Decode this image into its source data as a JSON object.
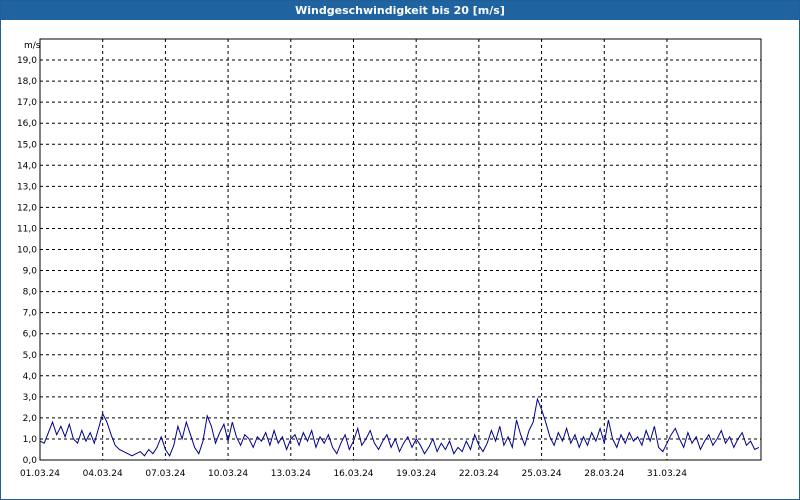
{
  "window": {
    "title": "Windgeschwindigkeit bis 20 [m/s]"
  },
  "colors": {
    "titlebar": "#1f64a0",
    "series": "#00008b",
    "grid": "#000000"
  },
  "chart_data": {
    "type": "line",
    "title": "Windgeschwindigkeit bis 20 [m/s]",
    "ylabel": "m/s",
    "ylim": [
      0,
      20
    ],
    "xlim_days": [
      1,
      35.5
    ],
    "grid": true,
    "yticks": [
      "0,0",
      "1,0",
      "2,0",
      "3,0",
      "4,0",
      "5,0",
      "6,0",
      "7,0",
      "8,0",
      "9,0",
      "10,0",
      "11,0",
      "12,0",
      "13,0",
      "14,0",
      "15,0",
      "16,0",
      "17,0",
      "18,0",
      "19,0"
    ],
    "xticks": [
      {
        "label": "01.03.24",
        "day": 1
      },
      {
        "label": "04.03.24",
        "day": 4
      },
      {
        "label": "07.03.24",
        "day": 7
      },
      {
        "label": "10.03.24",
        "day": 10
      },
      {
        "label": "13.03.24",
        "day": 13
      },
      {
        "label": "16.03.24",
        "day": 16
      },
      {
        "label": "19.03.24",
        "day": 19
      },
      {
        "label": "22.03.24",
        "day": 22
      },
      {
        "label": "25.03.24",
        "day": 25
      },
      {
        "label": "28.03.24",
        "day": 28
      },
      {
        "label": "31.03.24",
        "day": 31
      }
    ],
    "series": [
      {
        "values": [
          [
            1.0,
            0.9
          ],
          [
            1.2,
            0.8
          ],
          [
            1.4,
            1.3
          ],
          [
            1.6,
            1.8
          ],
          [
            1.8,
            1.2
          ],
          [
            2.0,
            1.6
          ],
          [
            2.2,
            1.1
          ],
          [
            2.4,
            1.7
          ],
          [
            2.6,
            1.0
          ],
          [
            2.8,
            0.8
          ],
          [
            3.0,
            1.4
          ],
          [
            3.2,
            0.9
          ],
          [
            3.4,
            1.3
          ],
          [
            3.6,
            0.8
          ],
          [
            3.8,
            1.5
          ],
          [
            4.0,
            2.2
          ],
          [
            4.2,
            1.8
          ],
          [
            4.4,
            1.2
          ],
          [
            4.6,
            0.7
          ],
          [
            4.8,
            0.5
          ],
          [
            5.0,
            0.4
          ],
          [
            5.2,
            0.3
          ],
          [
            5.4,
            0.2
          ],
          [
            5.6,
            0.3
          ],
          [
            5.8,
            0.4
          ],
          [
            6.0,
            0.2
          ],
          [
            6.2,
            0.5
          ],
          [
            6.4,
            0.3
          ],
          [
            6.6,
            0.6
          ],
          [
            6.8,
            1.1
          ],
          [
            7.0,
            0.5
          ],
          [
            7.2,
            0.2
          ],
          [
            7.4,
            0.7
          ],
          [
            7.6,
            1.6
          ],
          [
            7.8,
            1.0
          ],
          [
            8.0,
            1.8
          ],
          [
            8.2,
            1.2
          ],
          [
            8.4,
            0.6
          ],
          [
            8.6,
            0.3
          ],
          [
            8.8,
            0.9
          ],
          [
            9.0,
            2.1
          ],
          [
            9.2,
            1.6
          ],
          [
            9.4,
            0.8
          ],
          [
            9.6,
            1.3
          ],
          [
            9.8,
            1.7
          ],
          [
            10.0,
            0.9
          ],
          [
            10.2,
            1.8
          ],
          [
            10.4,
            1.1
          ],
          [
            10.6,
            0.7
          ],
          [
            10.8,
            1.2
          ],
          [
            11.0,
            1.0
          ],
          [
            11.2,
            0.6
          ],
          [
            11.4,
            1.1
          ],
          [
            11.6,
            0.9
          ],
          [
            11.8,
            1.3
          ],
          [
            12.0,
            0.7
          ],
          [
            12.2,
            1.4
          ],
          [
            12.4,
            0.8
          ],
          [
            12.6,
            1.1
          ],
          [
            12.8,
            0.5
          ],
          [
            13.0,
            1.0
          ],
          [
            13.2,
            1.2
          ],
          [
            13.4,
            0.7
          ],
          [
            13.6,
            1.3
          ],
          [
            13.8,
            0.9
          ],
          [
            14.0,
            1.4
          ],
          [
            14.2,
            0.6
          ],
          [
            14.4,
            1.1
          ],
          [
            14.6,
            0.8
          ],
          [
            14.8,
            1.2
          ],
          [
            15.0,
            0.6
          ],
          [
            15.2,
            0.3
          ],
          [
            15.4,
            0.8
          ],
          [
            15.6,
            1.2
          ],
          [
            15.8,
            0.5
          ],
          [
            16.0,
            0.9
          ],
          [
            16.2,
            1.5
          ],
          [
            16.4,
            0.7
          ],
          [
            16.6,
            1.0
          ],
          [
            16.8,
            1.4
          ],
          [
            17.0,
            0.8
          ],
          [
            17.2,
            0.5
          ],
          [
            17.4,
            0.9
          ],
          [
            17.6,
            1.2
          ],
          [
            17.8,
            0.6
          ],
          [
            18.0,
            1.0
          ],
          [
            18.2,
            0.4
          ],
          [
            18.4,
            0.8
          ],
          [
            18.6,
            1.1
          ],
          [
            18.8,
            0.6
          ],
          [
            19.0,
            1.0
          ],
          [
            19.2,
            0.7
          ],
          [
            19.4,
            0.3
          ],
          [
            19.6,
            0.6
          ],
          [
            19.8,
            1.0
          ],
          [
            20.0,
            0.4
          ],
          [
            20.2,
            0.8
          ],
          [
            20.4,
            0.5
          ],
          [
            20.6,
            0.9
          ],
          [
            20.8,
            0.3
          ],
          [
            21.0,
            0.6
          ],
          [
            21.2,
            0.4
          ],
          [
            21.4,
            0.9
          ],
          [
            21.6,
            0.5
          ],
          [
            21.8,
            1.2
          ],
          [
            22.0,
            0.7
          ],
          [
            22.2,
            0.4
          ],
          [
            22.4,
            0.8
          ],
          [
            22.6,
            1.4
          ],
          [
            22.8,
            0.9
          ],
          [
            23.0,
            1.6
          ],
          [
            23.2,
            0.7
          ],
          [
            23.4,
            1.1
          ],
          [
            23.6,
            0.6
          ],
          [
            23.8,
            1.9
          ],
          [
            24.0,
            1.2
          ],
          [
            24.2,
            0.7
          ],
          [
            24.4,
            1.4
          ],
          [
            24.6,
            1.8
          ],
          [
            24.8,
            2.9
          ],
          [
            25.0,
            2.4
          ],
          [
            25.2,
            1.8
          ],
          [
            25.4,
            1.1
          ],
          [
            25.6,
            0.7
          ],
          [
            25.8,
            1.3
          ],
          [
            26.0,
            0.9
          ],
          [
            26.2,
            1.5
          ],
          [
            26.4,
            0.8
          ],
          [
            26.6,
            1.2
          ],
          [
            26.8,
            0.6
          ],
          [
            27.0,
            1.1
          ],
          [
            27.2,
            0.7
          ],
          [
            27.4,
            1.3
          ],
          [
            27.6,
            0.9
          ],
          [
            27.8,
            1.5
          ],
          [
            28.0,
            0.8
          ],
          [
            28.2,
            1.9
          ],
          [
            28.4,
            1.0
          ],
          [
            28.6,
            0.6
          ],
          [
            28.8,
            1.2
          ],
          [
            29.0,
            0.8
          ],
          [
            29.2,
            1.3
          ],
          [
            29.4,
            0.9
          ],
          [
            29.6,
            1.1
          ],
          [
            29.8,
            0.7
          ],
          [
            30.0,
            1.4
          ],
          [
            30.2,
            0.9
          ],
          [
            30.4,
            1.6
          ],
          [
            30.6,
            0.6
          ],
          [
            30.8,
            0.4
          ],
          [
            31.0,
            0.8
          ],
          [
            31.2,
            1.2
          ],
          [
            31.4,
            1.5
          ],
          [
            31.6,
            1.0
          ],
          [
            31.8,
            0.6
          ],
          [
            32.0,
            1.3
          ],
          [
            32.2,
            0.8
          ],
          [
            32.4,
            1.1
          ],
          [
            32.6,
            0.5
          ],
          [
            32.8,
            0.9
          ],
          [
            33.0,
            1.2
          ],
          [
            33.2,
            0.7
          ],
          [
            33.4,
            1.0
          ],
          [
            33.6,
            1.4
          ],
          [
            33.8,
            0.8
          ],
          [
            34.0,
            1.1
          ],
          [
            34.2,
            0.6
          ],
          [
            34.4,
            1.0
          ],
          [
            34.6,
            1.3
          ],
          [
            34.8,
            0.7
          ],
          [
            35.0,
            0.9
          ],
          [
            35.2,
            0.5
          ],
          [
            35.4,
            0.6
          ]
        ]
      }
    ]
  }
}
